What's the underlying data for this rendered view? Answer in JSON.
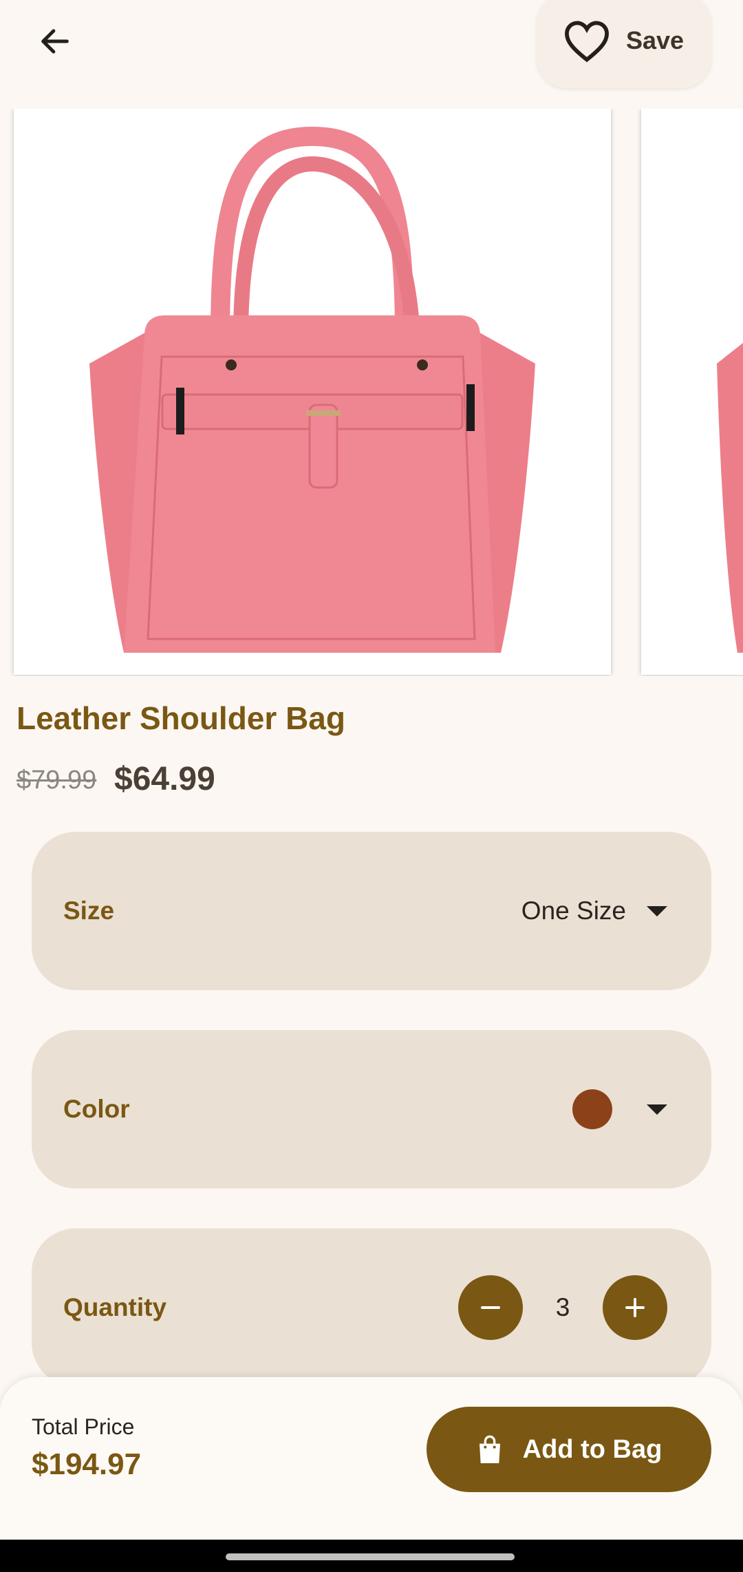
{
  "header": {
    "back_icon": "arrow-left-icon",
    "save_icon": "heart-outline-icon",
    "save_label": "Save"
  },
  "product": {
    "name": "Leather Shoulder Bag",
    "original_price": "$79.99",
    "sale_price": "$64.99",
    "image_color": "#ef8a93"
  },
  "options": {
    "size": {
      "label": "Size",
      "value": "One Size"
    },
    "color": {
      "label": "Color",
      "value_color": "#8c4218"
    },
    "quantity": {
      "label": "Quantity",
      "value": "3"
    }
  },
  "footer": {
    "total_label": "Total Price",
    "total_value": "$194.97",
    "add_label": "Add to Bag",
    "add_icon": "shopping-bag-icon"
  },
  "colors": {
    "accent": "#7a5813",
    "panel": "#ebe0d4",
    "background": "#fcf7f2"
  }
}
